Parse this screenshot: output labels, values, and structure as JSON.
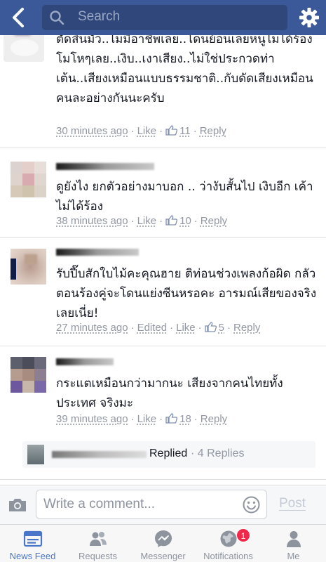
{
  "header": {
    "search_placeholder": "Search"
  },
  "comments": [
    {
      "text": "ตัดสินมั่ว..ไม่มีอาชีพเลย..โดนย้อนเลยหนูไม่ได้ร้อง โมโหๆเลย..เงิบ..เงาเสียง..ไม่ใช่ประกวดท่าเต้น..เสียงเหมือนแบบธรรมชาติ..กับดัดเสียงเหมือนคนละอย่างกันนะครับ",
      "time": "30 minutes ago",
      "like_label": "Like",
      "likes": "11",
      "reply_label": "Reply"
    },
    {
      "text": "ดูยังไง ยกตัวอย่างมาบอก .. ว่างับสั้นไป เงิบอีก เค้าไม่ได้ร้อง",
      "time": "38 minutes ago",
      "like_label": "Like",
      "likes": "10",
      "reply_label": "Reply"
    },
    {
      "text": "รับปี๊บสักใบไม้คะคุณฮาย ติท่อนช่วงเพลงก้อผิด กลัวตอนร้องคู่จะโดนแย่งซีนหรอคะ อารมณ์เสียของจริงเลยเนี่ย!",
      "time": "27 minutes ago",
      "edited_label": "Edited",
      "like_label": "Like",
      "likes": "5",
      "reply_label": "Reply"
    },
    {
      "text": "กระแตเหมือนกว่ามากนะ เสียงจากคนไทยทั้งประเทศ จริงมะ",
      "time": "39 minutes ago",
      "like_label": "Like",
      "likes": "18",
      "reply_label": "Reply"
    }
  ],
  "reply_summary": {
    "replied_label": "Replied",
    "count_label": "· 4 Replies"
  },
  "composer": {
    "placeholder": "Write a comment...",
    "post_label": "Post"
  },
  "tabs": [
    {
      "label": "News Feed",
      "icon": "news-feed-icon",
      "active": true
    },
    {
      "label": "Requests",
      "icon": "friend-requests-icon"
    },
    {
      "label": "Messenger",
      "icon": "messenger-icon"
    },
    {
      "label": "Notifications",
      "icon": "globe-icon",
      "badge": "1"
    },
    {
      "label": "Me",
      "icon": "person-icon"
    }
  ],
  "colors": {
    "brand": "#3b5998",
    "meta_gray": "#9197a3",
    "active_tab": "#4a76c9",
    "badge": "#f02849"
  }
}
